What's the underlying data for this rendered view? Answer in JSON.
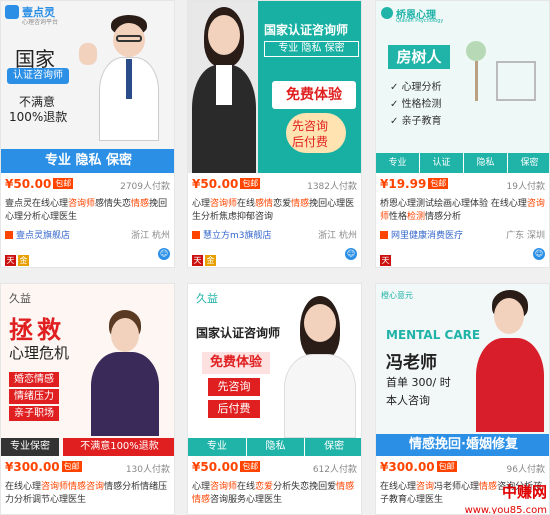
{
  "cards": [
    {
      "image": {
        "brand": "壹点灵",
        "brand_sub": "心理咨询平台",
        "title": "国家",
        "cert": "认证咨询师",
        "guarantee1": "不满意",
        "guarantee2": "100%退款",
        "bottom_bar": "专业  隐私  保密"
      },
      "price": "¥50.00",
      "badge": "包邮",
      "paid": "2709人付款",
      "desc_parts": [
        "壹点灵在线心理",
        "咨询师",
        "感情失恋",
        "情感",
        "挽回心理分析心理医生"
      ],
      "shop": "壹点灵旗舰店",
      "location": "浙江 杭州"
    },
    {
      "image": {
        "title": "国家认证咨询师",
        "sub": "专业  隐私  保密",
        "free": "免费体验",
        "consult1": "先咨询",
        "consult2": "后付费"
      },
      "price": "¥50.00",
      "badge": "包邮",
      "paid": "1382人付款",
      "desc_parts": [
        "心理",
        "咨询师",
        "在线",
        "感情",
        "恋爱",
        "情感",
        "挽回心理医生分析焦虑抑郁咨询"
      ],
      "shop": "慧立方m3旗舰店",
      "location": "浙江 杭州"
    },
    {
      "image": {
        "brand": "桥恩心理",
        "brand_sub": "Qiaoen Psychology",
        "title": "房树人",
        "items": [
          "心理分析",
          "性格检测",
          "亲子教育"
        ],
        "tabs": [
          "专业",
          "认证",
          "隐私",
          "保密"
        ]
      },
      "price": "¥19.99",
      "badge": "包邮",
      "paid": "19人付款",
      "desc_parts": [
        "桥恩心理测试绘画心理体验 在线心理",
        "咨询师",
        "性格",
        "检测",
        "情感分析"
      ],
      "shop": "网里健康消费医疗",
      "location": "广东 深圳"
    },
    {
      "image": {
        "brand": "久益",
        "title": "拯救",
        "sub": "心理危机",
        "items": [
          "婚恋情感",
          "情绪压力",
          "亲子职场"
        ],
        "left_tag": "专业保密",
        "right_tag": "不满意100%退款"
      },
      "price": "¥300.00",
      "badge": "包邮",
      "paid": "130人付款",
      "desc_parts": [
        "在线心理",
        "咨询师",
        "情感",
        "咨询",
        "情感分析情绪压力分析调节心理医生"
      ],
      "shop": "",
      "location": ""
    },
    {
      "image": {
        "brand": "久益",
        "title": "国家认证咨询师",
        "free": "免费体验",
        "consult1": "先咨询",
        "consult2": "后付费",
        "tabs": [
          "专业",
          "隐私",
          "保密"
        ]
      },
      "price": "¥50.00",
      "badge": "包邮",
      "paid": "612人付款",
      "desc_parts": [
        "心理",
        "咨询师",
        "在线",
        "恋爱",
        "分析失恋挽回爱",
        "情感",
        "情感",
        "咨询服务心理医生"
      ],
      "shop": "",
      "location": ""
    },
    {
      "image": {
        "brand": "橙心意元",
        "en": "MENTAL CARE",
        "name": "冯老师",
        "offer": "首单 300/ 时",
        "self": "本人咨询",
        "bottom_bar": "情感挽回·婚姻修复"
      },
      "price": "¥300.00",
      "badge": "包邮",
      "paid": "96人付款",
      "desc_parts": [
        "在线心理",
        "咨询",
        "冯老师心理",
        "情感",
        "咨询分析孩子教育心理医生"
      ],
      "shop": "",
      "location": ""
    }
  ],
  "watermark": {
    "line1": "中赚网",
    "line2": "www.you85.com"
  },
  "colors": {
    "accent": "#ff4400",
    "link": "#3366cc",
    "bar_blue": "#2b8fe6",
    "teal": "#20b3a8"
  }
}
